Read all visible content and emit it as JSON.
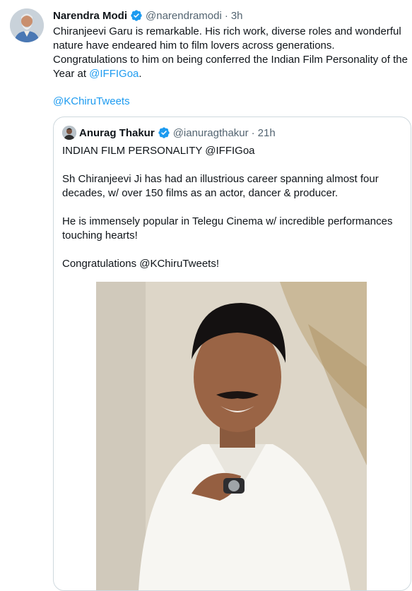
{
  "tweet": {
    "author_name": "Narendra Modi",
    "author_handle": "@narendramodi",
    "time": "3h",
    "text_before_link": "Chiranjeevi Garu is remarkable. His rich work, diverse roles and wonderful nature have endeared him to film lovers across generations. Congratulations to him on being conferred the Indian Film Personality of the Year at ",
    "text_link": "@IFFIGoa",
    "text_after_link": ".",
    "mention": "@KChiruTweets"
  },
  "quoted": {
    "author_name": "Anurag Thakur",
    "author_handle": "@ianuragthakur",
    "time": "21h",
    "paragraphs": [
      "INDIAN FILM PERSONALITY @IFFIGoa",
      "Sh Chiranjeevi Ji has had an illustrious career spanning almost four decades, w/ over 150 films as an actor, dancer & producer.",
      "He is immensely popular in Telegu Cinema w/ incredible performances touching hearts!",
      "Congratulations @KChiruTweets!"
    ]
  },
  "icons": {
    "verified": "verified-badge-icon"
  },
  "colors": {
    "link": "#1d9bf0",
    "verified": "#1d9bf0",
    "secondary_text": "#536471",
    "border": "#cfd9de"
  }
}
